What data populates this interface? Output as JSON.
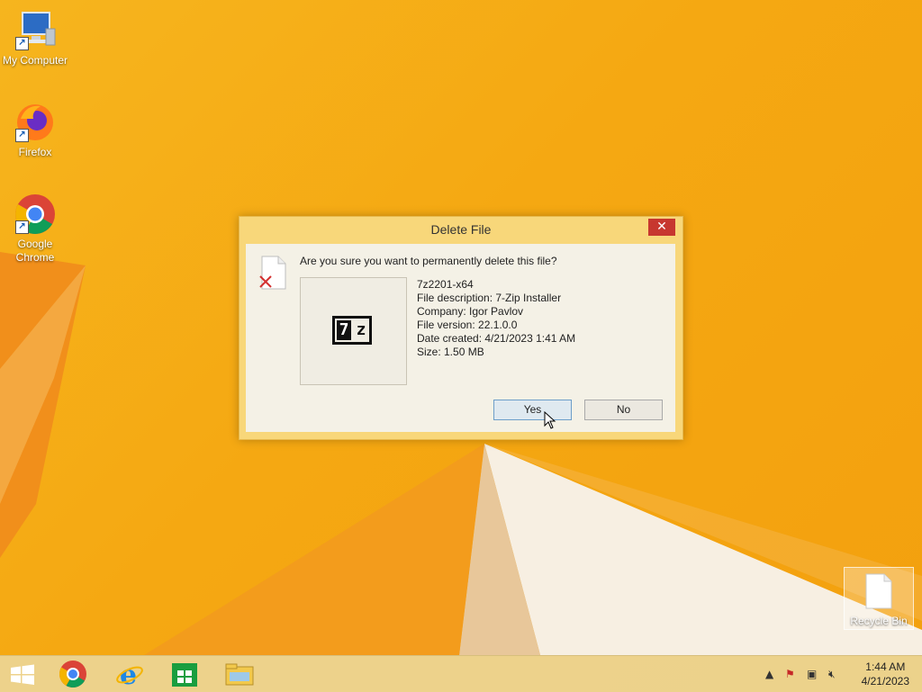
{
  "desktop": {
    "icons": [
      {
        "label": "My Computer"
      },
      {
        "label": "Firefox"
      },
      {
        "label": "Google Chrome"
      }
    ],
    "recycle_bin": {
      "label": "Recycle Bin"
    }
  },
  "dialog": {
    "title": "Delete File",
    "close_label": "✕",
    "question": "Are you sure you want to permanently delete this file?",
    "thumbnail_text": "7z",
    "file": {
      "name": "7z2201-x64",
      "description": "File description: 7-Zip Installer",
      "company": "Company: Igor Pavlov",
      "version": "File version: 22.1.0.0",
      "date_created": "Date created: 4/21/2023 1:41 AM",
      "size": "Size: 1.50 MB"
    },
    "yes_label": "Yes",
    "no_label": "No"
  },
  "taskbar": {
    "items": [
      "start-icon",
      "chrome-icon",
      "internet-explorer-icon",
      "store-icon",
      "file-explorer-icon"
    ],
    "tray": [
      "show-hidden-icons",
      "action-center-flag-icon",
      "network-icon",
      "volume-muted-icon"
    ],
    "clock_time": "1:44 AM",
    "clock_date": "4/21/2023"
  }
}
